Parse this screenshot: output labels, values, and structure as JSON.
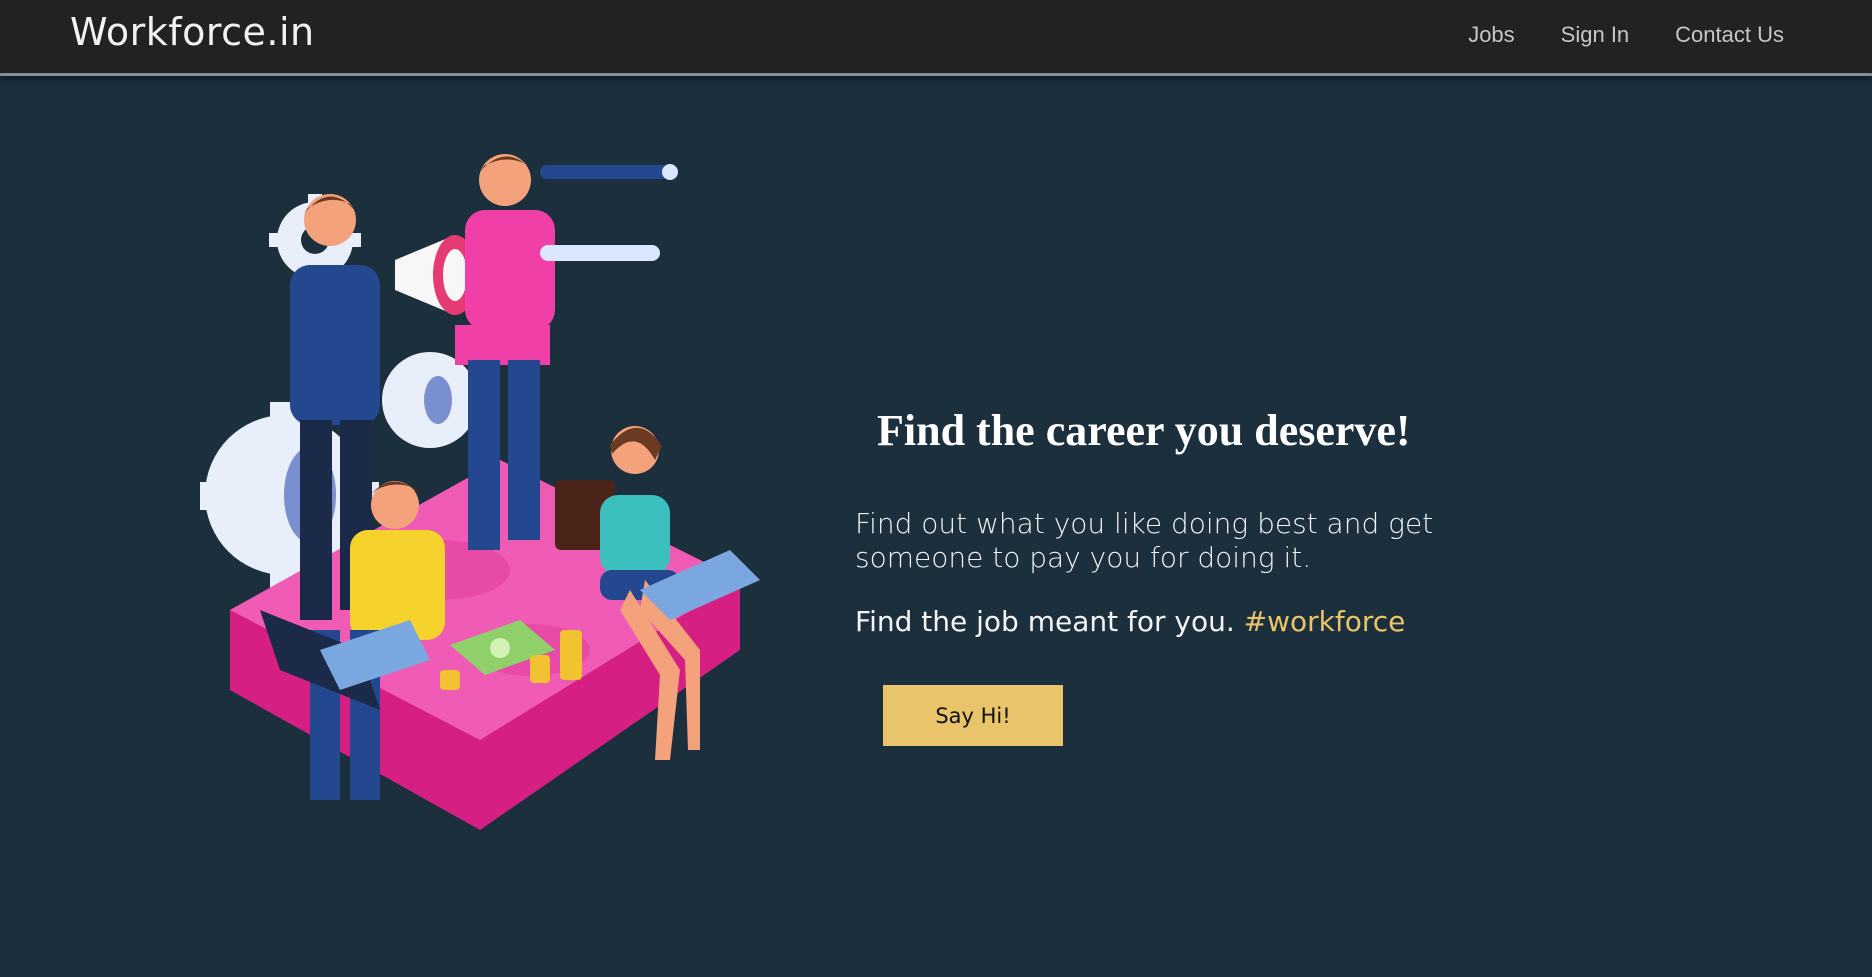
{
  "nav": {
    "brand": "Workforce.in",
    "links": [
      "Jobs",
      "Sign In",
      "Contact Us"
    ]
  },
  "hero": {
    "title": "Find the career you deserve!",
    "description": "Find out what you like doing best and get someone to pay you for doing it.",
    "tagline": "Find the job meant for you.",
    "hashtag": "#workforce",
    "button_label": "Say Hi!"
  },
  "colors": {
    "background": "#1b2f3c",
    "navbar": "#222222",
    "accent": "#e9c46a",
    "pink": "#f03fa6"
  },
  "illustration": {
    "name": "team-career-illustration"
  }
}
